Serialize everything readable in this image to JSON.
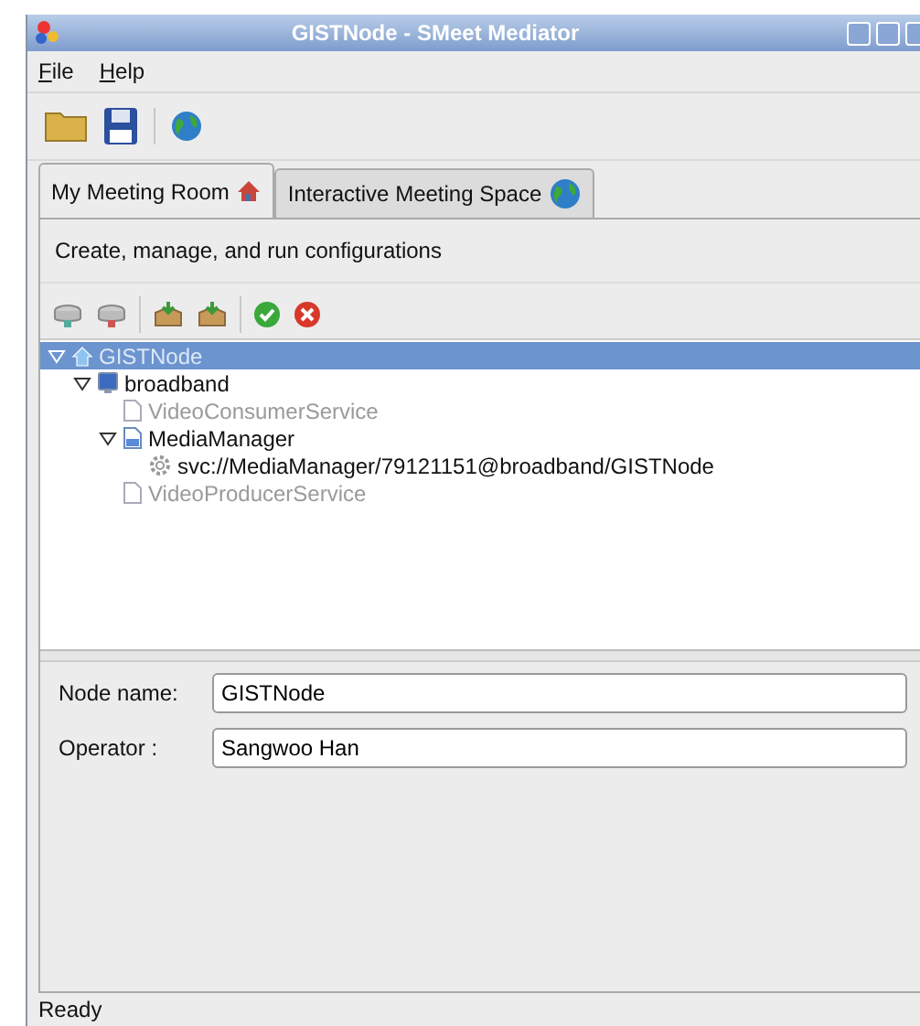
{
  "window": {
    "title": "GISTNode - SMeet Mediator"
  },
  "menu": [
    {
      "label": "File"
    },
    {
      "label": "Help"
    }
  ],
  "toolbar": [
    {
      "kind": "open"
    },
    {
      "kind": "save"
    },
    {
      "kind": "sep"
    },
    {
      "kind": "globe"
    }
  ],
  "tabs": [
    {
      "label": "My Meeting Room",
      "kind": "home",
      "selected": true
    },
    {
      "label": "Interactive Meeting Space",
      "kind": "globe",
      "selected": false
    }
  ],
  "description": "Create, manage, and run configurations",
  "tree_toolbar": [
    {
      "kind": "disk-add"
    },
    {
      "kind": "disk-remove"
    },
    {
      "kind": "sep"
    },
    {
      "kind": "box-add"
    },
    {
      "kind": "box-add"
    },
    {
      "kind": "sep"
    },
    {
      "kind": "ok"
    },
    {
      "kind": "cancel"
    }
  ],
  "tree": [
    {
      "label": "GISTNode",
      "kind": "home",
      "selected": true,
      "disabled": false,
      "expanded": true,
      "children": [
        {
          "label": "broadband",
          "kind": "computer",
          "selected": false,
          "disabled": false,
          "expanded": true,
          "children": [
            {
              "label": "VideoConsumerService",
              "kind": "doc",
              "selected": false,
              "disabled": true
            },
            {
              "label": "MediaManager",
              "kind": "doc",
              "selected": false,
              "disabled": false,
              "expanded": true,
              "children": [
                {
                  "label": "svc://MediaManager/79121151@broadband/GISTNode",
                  "kind": "gear",
                  "selected": false,
                  "disabled": false
                }
              ]
            },
            {
              "label": "VideoProducerService",
              "kind": "doc",
              "selected": false,
              "disabled": true
            }
          ]
        }
      ]
    }
  ],
  "form": [
    {
      "label": "Node name:",
      "value": "GISTNode"
    },
    {
      "label": "Operator :",
      "value": "Sangwoo Han"
    }
  ],
  "status_bar": "Ready"
}
